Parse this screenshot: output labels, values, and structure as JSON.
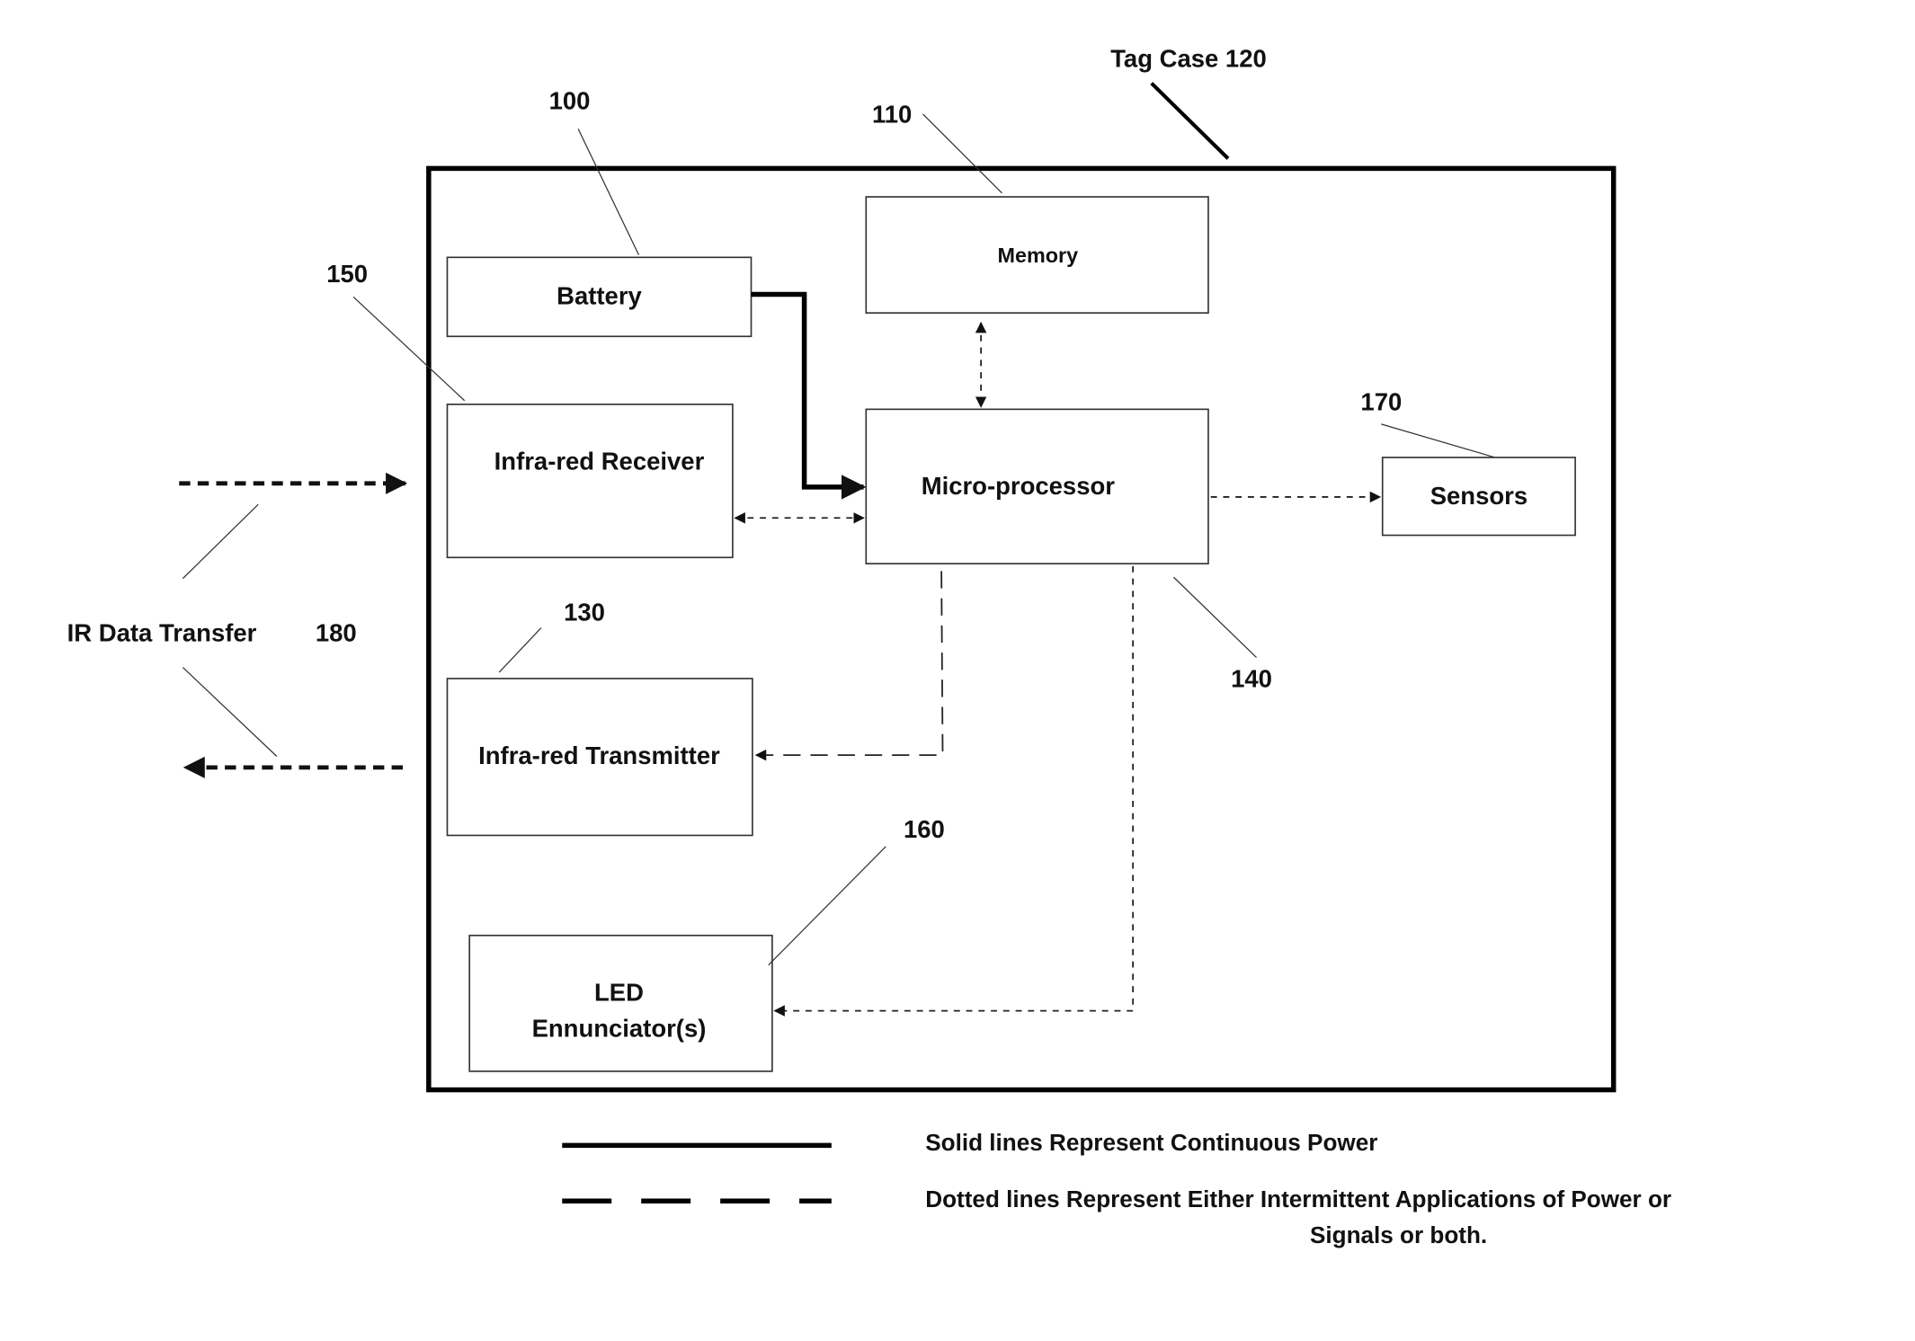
{
  "figure": {
    "case_label": "Tag Case 120",
    "blocks": {
      "battery": {
        "label": "Battery",
        "ref": "100"
      },
      "memory": {
        "label": "Memory",
        "ref": "110"
      },
      "microprocessor": {
        "label": "Micro-processor",
        "ref": "140"
      },
      "ir_receiver": {
        "label": "Infra-red Receiver",
        "ref": "150"
      },
      "ir_transmitter": {
        "label": "Infra-red Transmitter",
        "ref": "130"
      },
      "led": {
        "label_line1": "LED",
        "label_line2": "Ennunciator(s)",
        "ref": "160"
      },
      "sensors": {
        "label": "Sensors",
        "ref": "170"
      }
    },
    "ir_transfer": {
      "label": "IR Data Transfer",
      "ref": "180"
    }
  },
  "legend": {
    "solid": "Solid lines Represent Continuous Power",
    "dashed_line1": "Dotted lines Represent Either Intermittent Applications of Power or",
    "dashed_line2": "Signals or both."
  }
}
